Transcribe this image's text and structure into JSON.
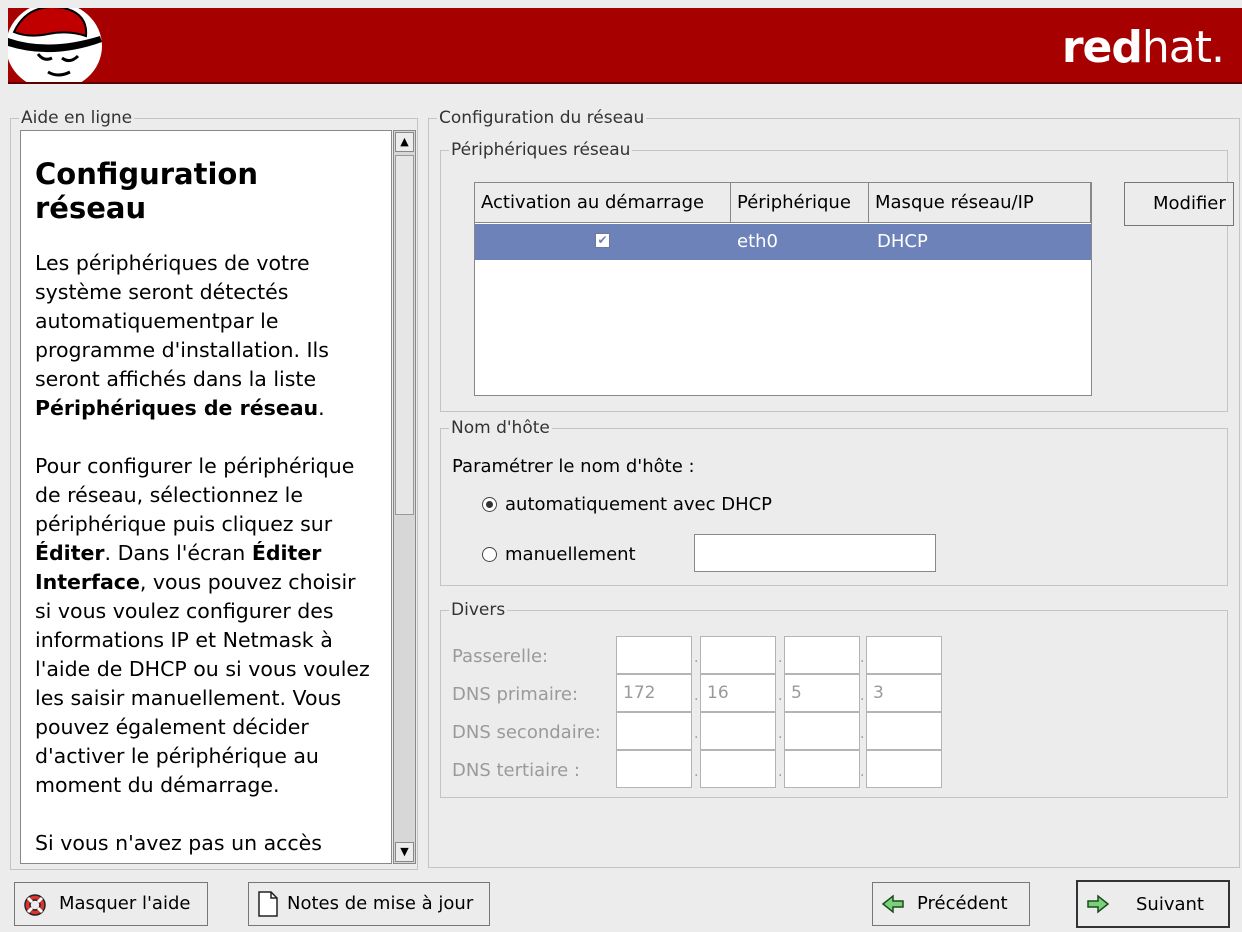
{
  "header": {
    "brand_bold": "red",
    "brand_light": "hat."
  },
  "help": {
    "frame_title": "Aide en ligne",
    "heading": "Configuration réseau",
    "p1_text": "Les périphériques de votre système seront détectés automatiquementpar le programme d'installation. Ils seront affichés dans la liste ",
    "p1_bold": "Périphériques de réseau",
    "p1_end": ".",
    "p2_a": "Pour configurer le périphérique de réseau, sélectionnez le périphérique puis cliquez sur ",
    "p2_b": "Éditer",
    "p2_c": ". Dans l'écran ",
    "p2_d": "Éditer Interface",
    "p2_e": ", vous pouvez choisir si vous voulez configurer des informations IP et Netmask à l'aide de DHCP ou si vous voulez les saisir manuellement. Vous pouvez également décider d'activer le périphérique au moment du démarrage.",
    "p3": "Si vous n'avez pas un accès"
  },
  "config": {
    "frame_title": "Configuration du réseau",
    "devices": {
      "frame_title": "Périphériques réseau",
      "columns": [
        "Activation au démarrage",
        "Périphérique",
        "Masque réseau/IP"
      ],
      "rows": [
        {
          "active": true,
          "device": "eth0",
          "mask": "DHCP"
        }
      ],
      "modify_label": "Modifier"
    },
    "hostname": {
      "frame_title": "Nom d'hôte",
      "prompt": "Paramétrer le nom d'hôte :",
      "option_auto": "automatiquement avec DHCP",
      "option_manual": "manuellement",
      "selected": "auto",
      "manual_value": ""
    },
    "misc": {
      "frame_title": "Divers",
      "gateway_label": "Passerelle:",
      "dns1_label": "DNS primaire:",
      "dns2_label": "DNS secondaire:",
      "dns3_label": "DNS tertiaire :",
      "gateway": [
        "",
        "",
        "",
        ""
      ],
      "dns1": [
        "172",
        "16",
        "5",
        "3"
      ],
      "dns2": [
        "",
        "",
        "",
        ""
      ],
      "dns3": [
        "",
        "",
        "",
        ""
      ]
    }
  },
  "buttons": {
    "hide_help": "Masquer l'aide",
    "release_notes": "Notes de mise à jour",
    "back": "Précédent",
    "next": "Suivant"
  },
  "colors": {
    "header": "#a70000",
    "selection": "#6c82b8",
    "window": "#ececec"
  }
}
